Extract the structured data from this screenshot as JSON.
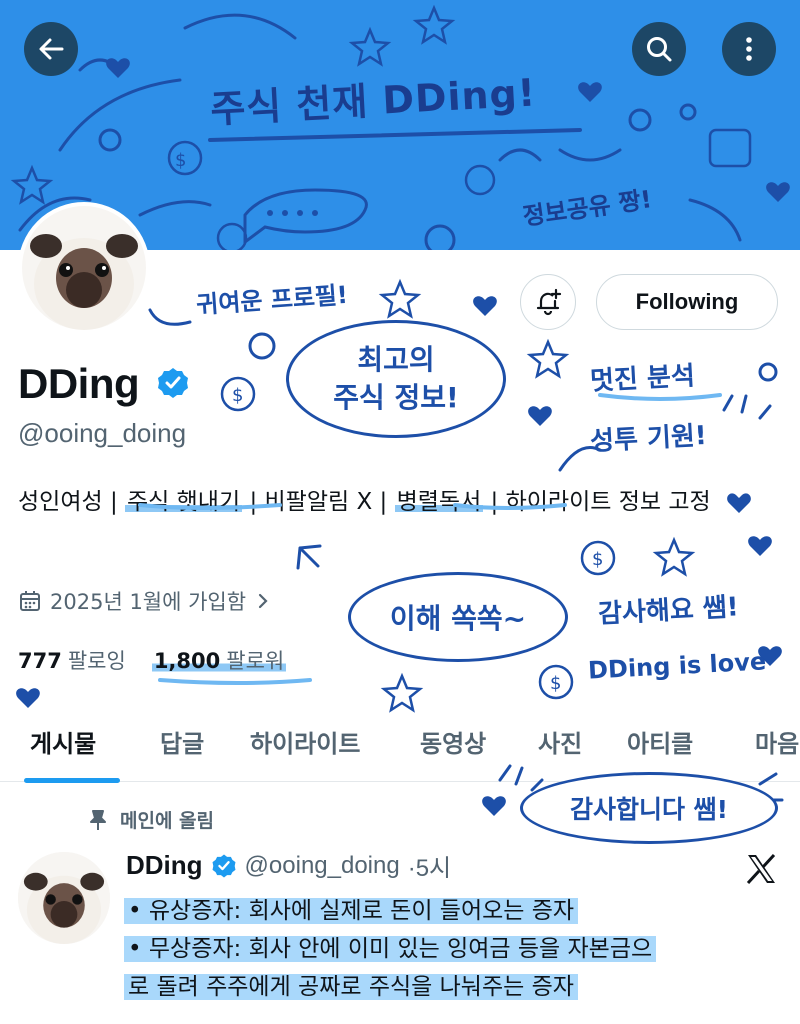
{
  "banner": {
    "title": "주식 천재 DDing!",
    "subtitle": "정보공유 짱!"
  },
  "nav": {
    "back_icon": "arrow-left-icon",
    "search_icon": "search-icon",
    "more_icon": "more-vertical-icon"
  },
  "profile": {
    "name": "DDing",
    "handle": "@ooing_doing",
    "bio": {
      "part1": "성인여성 | ",
      "hl1": "주식 햇내기",
      "part2": " | 비팔알림 X | ",
      "hl2": "병렬독서",
      "part3": " | 하이라이트 정보 고정"
    },
    "joined": "2025년 1월에 가입함",
    "following_count": "777",
    "following_label": "팔로잉",
    "followers_count": "1,800",
    "followers_label": "팔로워"
  },
  "actions": {
    "follow_label": "Following"
  },
  "tabs": [
    "게시물",
    "답글",
    "하이라이트",
    "동영상",
    "사진",
    "아티클",
    "마음"
  ],
  "post": {
    "pinned_label": "메인에 올림",
    "author": "DDing",
    "handle": "@ooing_doing",
    "time": "·5시",
    "line1": "• 유상증자: 회사에 실제로 돈이 들어오는 증자",
    "line2": "• 무상증자: 회사 안에 이미 있는 잉여금 등을 자본금으",
    "line3": "로 돌려 주주에게 공짜로 주식을 나눠주는 증자"
  },
  "notes": {
    "cute_profile": "귀여운 프로필!",
    "best_info_1": "최고의",
    "best_info_2": "주식 정보!",
    "nice_analysis": "멋진 분석",
    "good_luck": "성투 기원!",
    "easy": "이해 쏙쏙~",
    "thanks_ssaem": "감사해요 쌤!",
    "love": "DDing is love",
    "thank_you": "감사합니다 쌤!"
  },
  "colors": {
    "banner": "#2e8fe8",
    "doodle": "#1d4fa8",
    "accent": "#1d9bf0",
    "highlight": "#8ec8f5"
  }
}
